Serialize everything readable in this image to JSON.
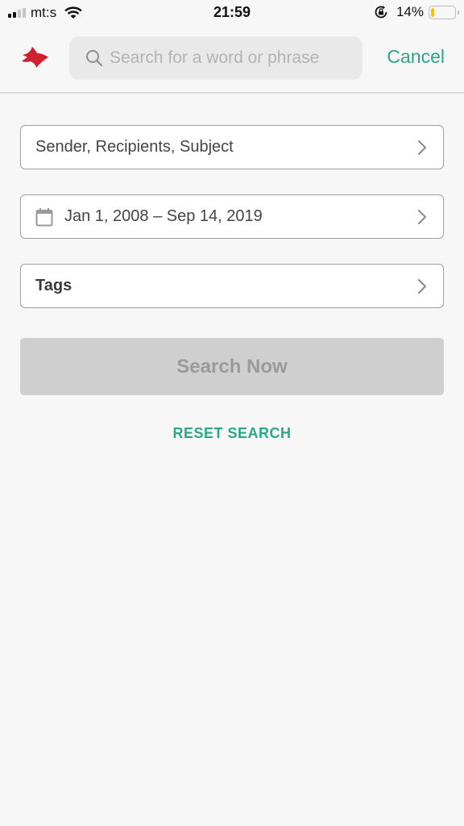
{
  "status_bar": {
    "carrier": "mt:s",
    "time": "21:59",
    "battery_percent_label": "14%",
    "battery_level": 0.14,
    "icons": [
      "signal-icon",
      "wifi-icon",
      "rotation-lock-icon",
      "battery-icon"
    ]
  },
  "header": {
    "logo_icon": "bird-logo-icon",
    "search": {
      "placeholder": "Search for a word or phrase",
      "value": "",
      "icon": "search-icon"
    },
    "cancel_label": "Cancel"
  },
  "filters": {
    "people": {
      "label": "Sender, Recipients, Subject",
      "icon": "chevron-right-icon"
    },
    "date_range": {
      "label": "Jan 1, 2008 – Sep 14, 2019",
      "icon": "calendar-icon"
    },
    "tags": {
      "label": "Tags",
      "icon": "chevron-right-icon"
    }
  },
  "actions": {
    "search_now_label": "Search Now",
    "reset_label": "RESET SEARCH"
  },
  "colors": {
    "accent": "#2aa78a",
    "logo": "#d3202e",
    "disabled_button": "#cfcfcf",
    "battery_fill": "#f4c20d"
  }
}
